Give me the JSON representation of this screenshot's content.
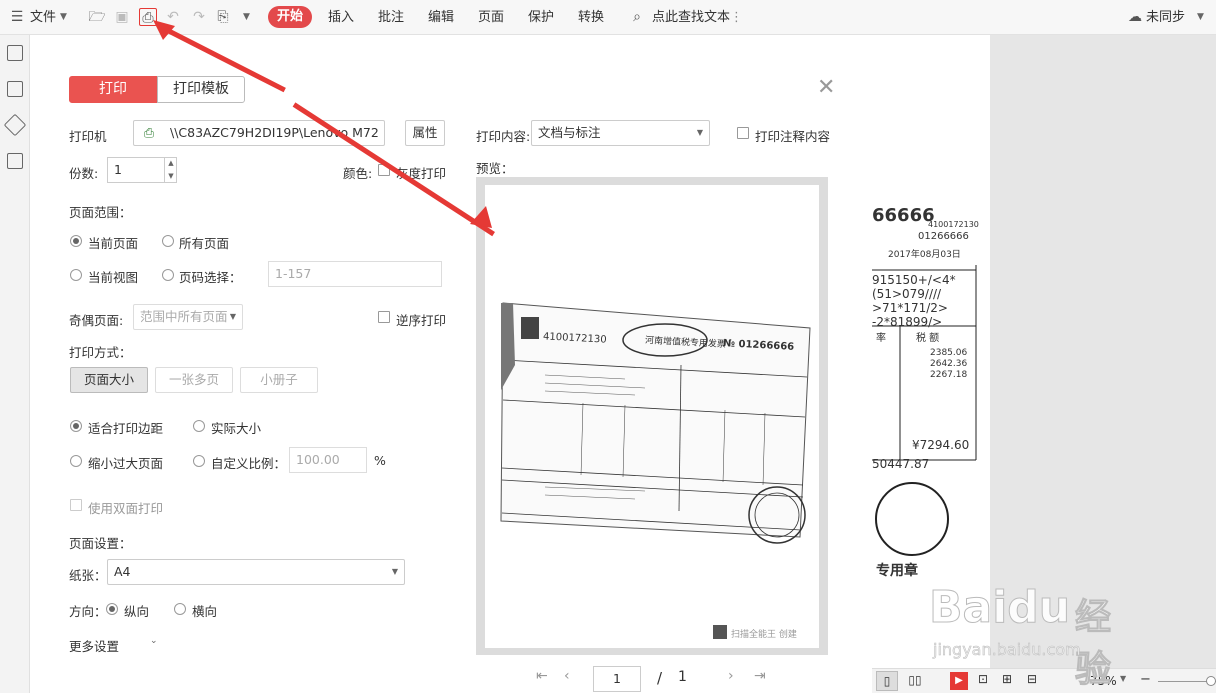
{
  "toolbar": {
    "file_label": "文件",
    "start_label": "开始",
    "menu": [
      "插入",
      "批注",
      "编辑",
      "页面",
      "保护",
      "转换"
    ],
    "search_label": "点此查找文本",
    "sync_label": "未同步"
  },
  "dialog": {
    "tab_print": "打印",
    "tab_template": "打印模板",
    "printer_label": "打印机",
    "printer_value": "\\\\C83AZC79H2DI19P\\Lenovo M72",
    "properties_button": "属性",
    "copies_label": "份数:",
    "copies_value": "1",
    "color_label": "颜色:",
    "grayscale_label": "灰度打印",
    "page_range_title": "页面范围：",
    "current_page": "当前页面",
    "all_pages": "所有页面",
    "current_view": "当前视图",
    "page_select": "页码选择：",
    "page_select_placeholder": "1-157",
    "odd_even_label": "奇偶页面:",
    "odd_even_value": "范围中所有页面",
    "reverse_print": "逆序打印",
    "print_mode_title": "打印方式：",
    "mode_page_size": "页面大小",
    "mode_multi": "一张多页",
    "mode_booklet": "小册子",
    "fit_margin": "适合打印边距",
    "actual_size": "实际大小",
    "shrink_large": "缩小过大页面",
    "custom_scale": "自定义比例：",
    "scale_value": "100.00",
    "percent": "%",
    "duplex": "使用双面打印",
    "page_setup_title": "页面设置：",
    "paper_label": "纸张：",
    "paper_value": "A4",
    "orientation_label": "方向：",
    "portrait": "纵向",
    "landscape": "横向",
    "more_settings": "更多设置",
    "print_content_label": "打印内容:",
    "print_content_value": "文档与标注",
    "print_comments": "打印注释内容",
    "preview_label": "预览：",
    "page_current": "1",
    "page_sep": "/",
    "page_total": "1"
  },
  "preview_doc": {
    "invoice_no": "4100172130",
    "invoice_title": "河南增值税专用发票",
    "invoice_num": "№ 01266666",
    "footer": "扫描全能王 创建"
  },
  "right_doc": {
    "line1": "66666",
    "line1b": "4100172130",
    "line2": "01266666",
    "line3": "2017年08月03日",
    "c1": "915150+/<4*",
    "c2": "(51>079////",
    "c3": ">71*171/2>",
    "c4": "-2*81899/>",
    "h1": "率",
    "h2": "税    额",
    "v1": "2385.06",
    "v2": "2642.36",
    "v3": "2267.18",
    "total": "¥7294.60",
    "total2": "50447.87",
    "stamp": "专用章"
  },
  "status": {
    "zoom": "75%"
  },
  "watermark": {
    "brand": "Baidu",
    "brand_cn": "经验",
    "url": "jingyan.baidu.com"
  }
}
